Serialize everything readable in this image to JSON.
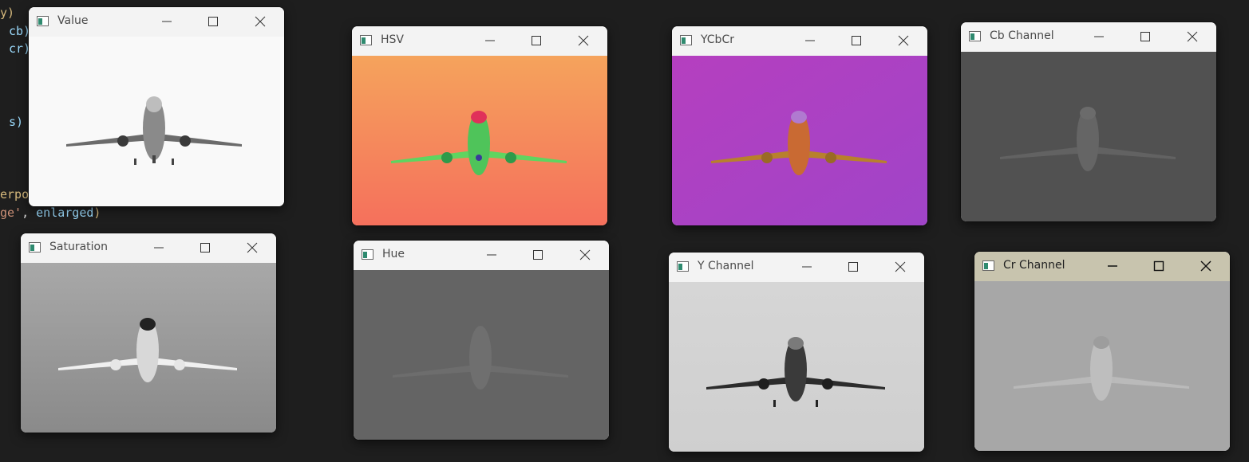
{
  "code": {
    "line1": "y)",
    "line2": "cb)",
    "line3": "cr)",
    "line4": "s)",
    "line5_prefix": "erpol",
    "line6_str": "ge'",
    "line6_rest": ", ",
    "line6_var": "enlarged",
    "line6_close": ")"
  },
  "windows": [
    {
      "key": "value",
      "title": "Value"
    },
    {
      "key": "hsv",
      "title": "HSV"
    },
    {
      "key": "ycbcr",
      "title": "YCbCr"
    },
    {
      "key": "cb",
      "title": "Cb Channel"
    },
    {
      "key": "saturation",
      "title": "Saturation"
    },
    {
      "key": "hue",
      "title": "Hue"
    },
    {
      "key": "y",
      "title": "Y Channel"
    },
    {
      "key": "cr",
      "title": "Cr Channel"
    }
  ],
  "colors": {
    "desktop": "#1e1e1e",
    "titlebar": "#f3f3f3",
    "titlebar_active": "#c8c4ae"
  }
}
